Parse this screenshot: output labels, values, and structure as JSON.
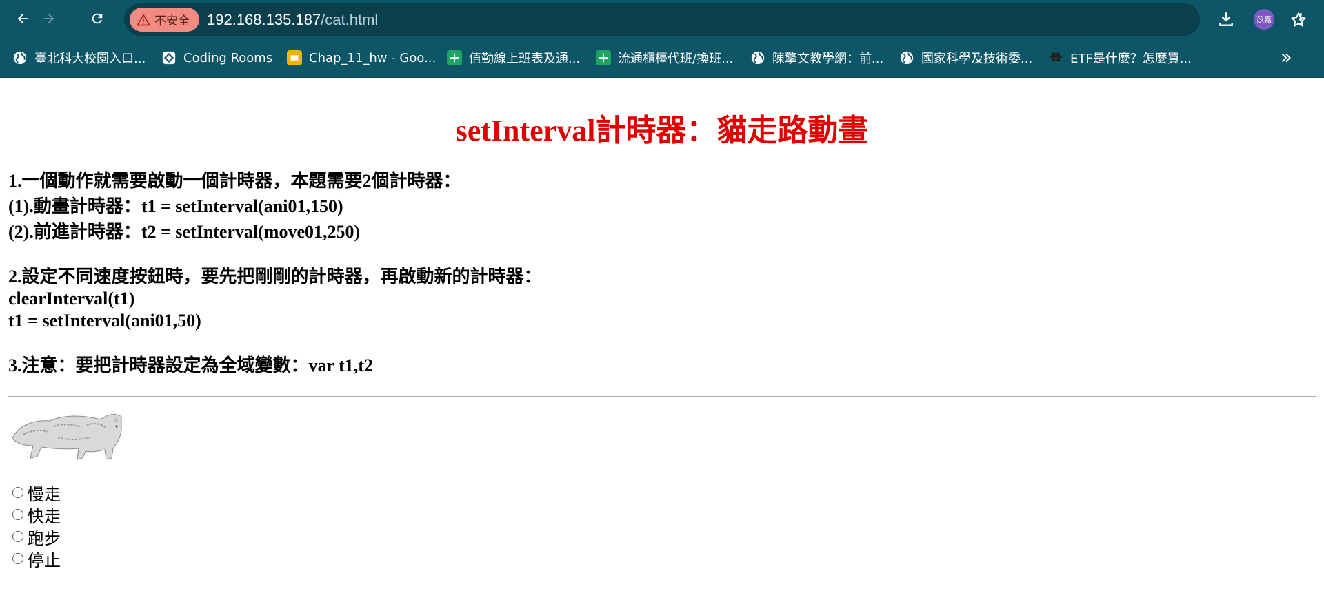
{
  "browser": {
    "security_label": "不安全",
    "url_host": "192.168.135.187",
    "url_path": "/cat.html",
    "profile_initials": "苡嘉",
    "theme_color": "#0c5668"
  },
  "bookmarks": [
    {
      "label": "臺北科大校園入口...",
      "icon": "globe-icon"
    },
    {
      "label": "Coding Rooms",
      "icon": "coding-rooms-icon"
    },
    {
      "label": "Chap_11_hw - Goo...",
      "icon": "google-slides-icon"
    },
    {
      "label": "值勤線上班表及通...",
      "icon": "google-sheets-icon"
    },
    {
      "label": "流通櫃檯代班/換班...",
      "icon": "google-sheets-icon"
    },
    {
      "label": "陳擎文教學網：前...",
      "icon": "globe-icon"
    },
    {
      "label": "國家科學及技術委...",
      "icon": "globe-icon"
    },
    {
      "label": "ETF是什麼？怎麼買...",
      "icon": "spy-icon"
    }
  ],
  "page": {
    "title": "setInterval計時器：貓走路動畫",
    "title_color": "#e00000",
    "p1_line1": "1.一個動作就需要啟動一個計時器，本題需要2個計時器：",
    "p1_line2": "(1).動畫計時器：t1 = setInterval(ani01,150)",
    "p1_line3": "(2).前進計時器：t2 = setInterval(move01,250)",
    "p2_line1": "2.設定不同速度按鈕時，要先把剛剛的計時器，再啟動新的計時器：",
    "p2_line2": "clearInterval(t1)",
    "p2_line3": "t1 = setInterval(ani01,50)",
    "p3_line1": "3.注意：要把計時器設定為全域變數：var t1,t2",
    "radios": [
      "慢走",
      "快走",
      "跑步",
      "停止"
    ]
  }
}
